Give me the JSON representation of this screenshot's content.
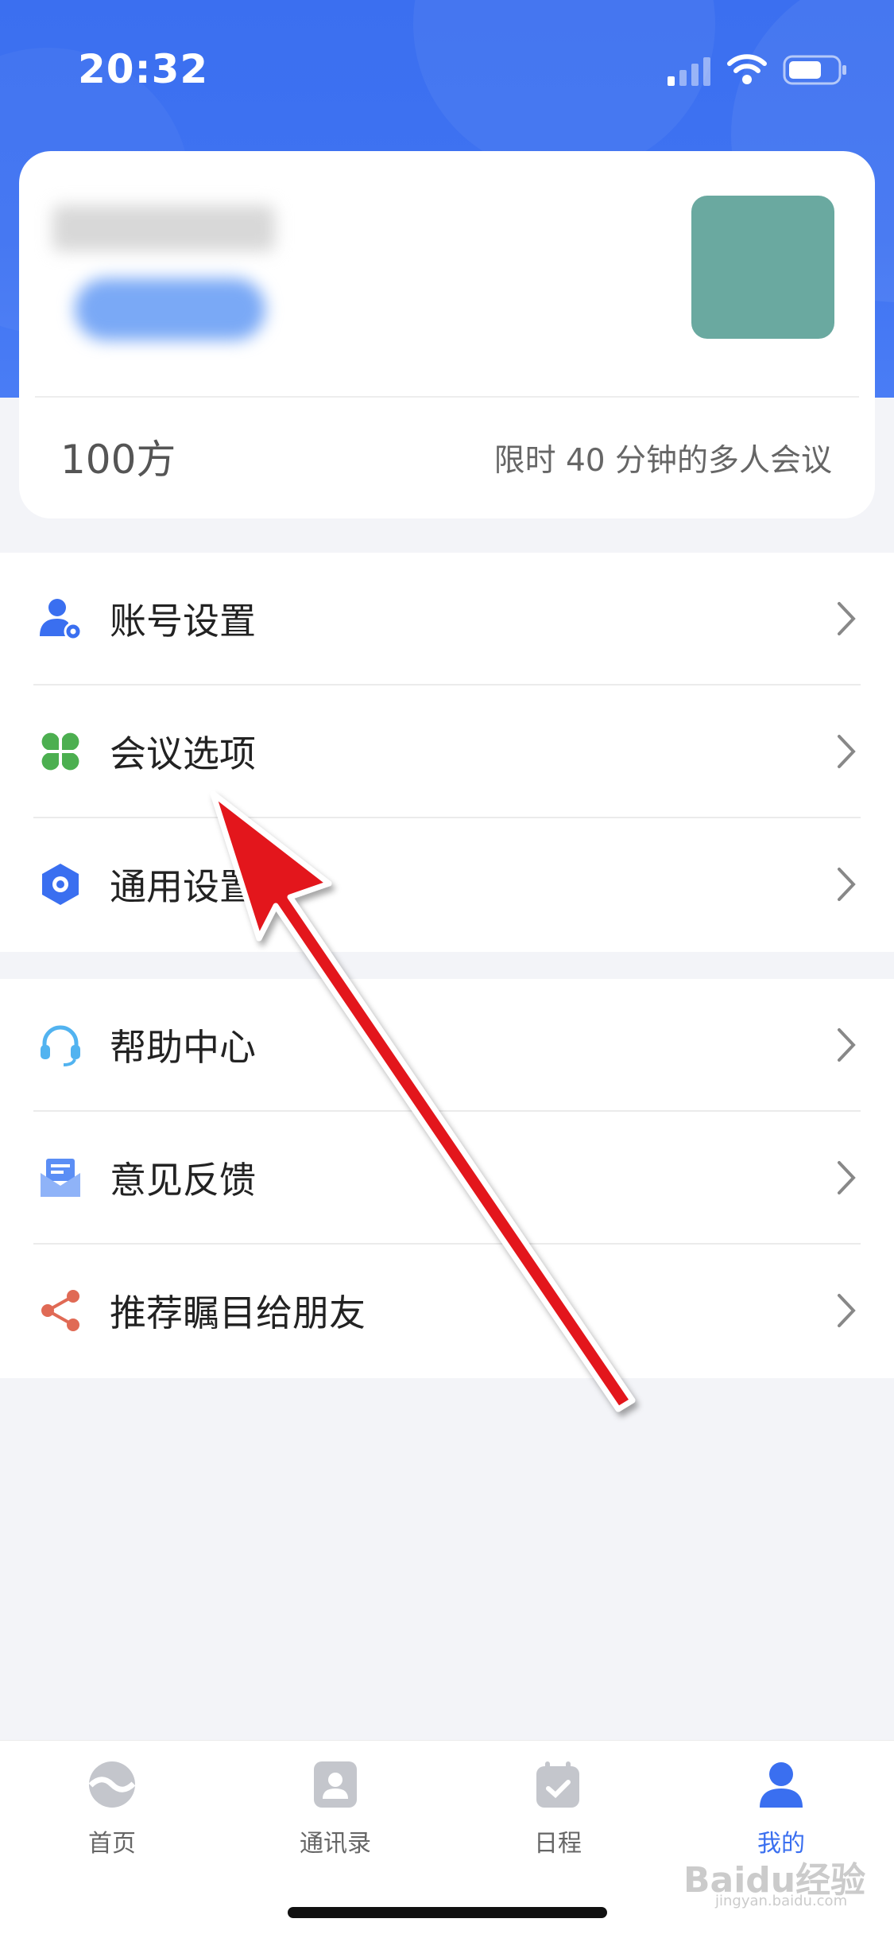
{
  "status_bar": {
    "time": "20:32"
  },
  "profile": {
    "plan": "100方",
    "plan_desc": "限时 40 分钟的多人会议"
  },
  "menu_group_1": [
    {
      "label": "账号设置",
      "icon": "account-settings-icon"
    },
    {
      "label": "会议选项",
      "icon": "clover-icon"
    },
    {
      "label": "通用设置",
      "icon": "hex-gear-icon"
    }
  ],
  "menu_group_2": [
    {
      "label": "帮助中心",
      "icon": "headset-icon"
    },
    {
      "label": "意见反馈",
      "icon": "mail-icon"
    },
    {
      "label": "推荐瞩目给朋友",
      "icon": "share-icon"
    }
  ],
  "tabbar": [
    {
      "label": "首页",
      "icon": "home-logo-icon"
    },
    {
      "label": "通讯录",
      "icon": "contacts-icon"
    },
    {
      "label": "日程",
      "icon": "calendar-icon"
    },
    {
      "label": "我的",
      "icon": "profile-icon",
      "active": true
    }
  ],
  "watermark": {
    "text": "Baidu经验",
    "sub": "jingyan.baidu.com"
  },
  "colors": {
    "accent": "#3a6ff0",
    "header": "#3f73f2",
    "arrow": "#e3141b"
  }
}
